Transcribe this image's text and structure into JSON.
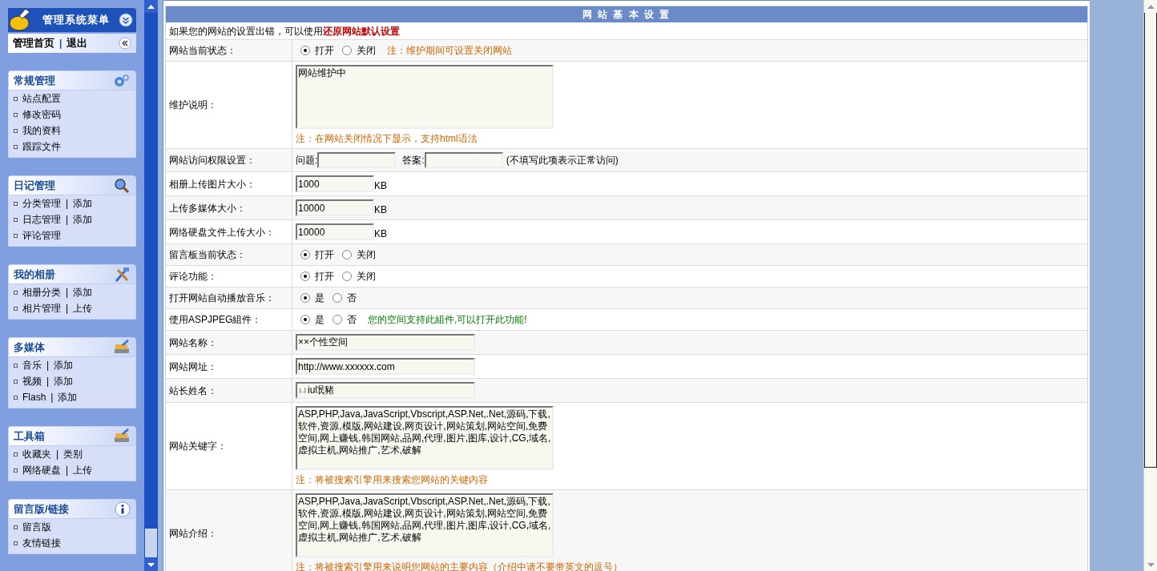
{
  "sidebar": {
    "title": "管理系统菜单",
    "quick_links": {
      "home": "管理首页",
      "separator": "|",
      "logout": "退出"
    },
    "panels": [
      {
        "title": "常规管理",
        "items": [
          {
            "label": "站点配置"
          },
          {
            "label": "修改密码"
          },
          {
            "label": "我的资料"
          },
          {
            "label": "跟踪文件"
          }
        ]
      },
      {
        "title": "日记管理",
        "items": [
          {
            "label": "分类管理",
            "separator": "|",
            "extra": "添加"
          },
          {
            "label": "日志管理",
            "separator": "|",
            "extra": "添加"
          },
          {
            "label": "评论管理"
          }
        ]
      },
      {
        "title": "我的相册",
        "items": [
          {
            "label": "相册分类",
            "separator": "|",
            "extra": "添加"
          },
          {
            "label": "相片管理",
            "separator": "|",
            "extra": "上传"
          }
        ]
      },
      {
        "title": "多媒体",
        "items": [
          {
            "label": "音乐",
            "separator": "|",
            "extra": "添加"
          },
          {
            "label": "视频",
            "separator": "|",
            "extra": "添加"
          },
          {
            "label": "Flash",
            "separator": "|",
            "extra": "添加"
          }
        ]
      },
      {
        "title": "工具箱",
        "items": [
          {
            "label": "收藏夹",
            "separator": "|",
            "extra": "类别"
          },
          {
            "label": "网络硬盘",
            "separator": "|",
            "extra": "上传"
          }
        ]
      },
      {
        "title": "留言版/链接",
        "items": [
          {
            "label": "留言版"
          },
          {
            "label": "友情链接"
          }
        ]
      }
    ]
  },
  "settings": {
    "title": "网 站 基 本 设 置",
    "notice": "如果您的网站的设置出错，可以使用**还原网站默认设置**",
    "rows": [
      {
        "kind": "radio",
        "label": "网站当前状态：",
        "options": [
          {
            "label": "打开",
            "selected": true
          },
          {
            "label": "关闭",
            "selected": false
          }
        ],
        "note": "注：维护期间可设置关闭网站"
      },
      {
        "kind": "textarea",
        "label": "维护说明：",
        "value": "网站维护中",
        "note": "注：在网站关闭情况下显示，支持html语法"
      },
      {
        "kind": "qa",
        "label": "网站访问权限设置：",
        "question_label": "问题:",
        "answer_label": "答案:",
        "hint": "(不填写此项表示正常访问)"
      },
      {
        "kind": "number",
        "label": "相册上传图片大小：",
        "value": "1000",
        "unit": "KB"
      },
      {
        "kind": "number",
        "label": "上传多媒体大小：",
        "value": "10000",
        "unit": "KB"
      },
      {
        "kind": "number",
        "label": "网络硬盘文件上传大小：",
        "value": "10000",
        "unit": "KB"
      },
      {
        "kind": "radio",
        "label": "留言板当前状态：",
        "options": [
          {
            "label": "打开",
            "selected": true
          },
          {
            "label": "关闭",
            "selected": false
          }
        ]
      },
      {
        "kind": "radio",
        "label": "评论功能：",
        "options": [
          {
            "label": "打开",
            "selected": true
          },
          {
            "label": "关闭",
            "selected": false
          }
        ]
      },
      {
        "kind": "radio",
        "label": "打开网站自动播放音乐：",
        "options": [
          {
            "label": "是",
            "selected": true
          },
          {
            "label": "否",
            "selected": false
          }
        ]
      },
      {
        "kind": "radio",
        "label": "使用ASPJPEG組件：",
        "options": [
          {
            "label": "是",
            "selected": true
          },
          {
            "label": "否",
            "selected": false
          }
        ],
        "note": "您的空间支持此組件,可以打开此功能!"
      },
      {
        "kind": "text",
        "label": "网站名称：",
        "value": "××个性空间"
      },
      {
        "kind": "text",
        "label": "网站网址：",
        "value": "http://www.xxxxxx.com"
      },
      {
        "kind": "text",
        "label": "站长姓名：",
        "value": "ㄩiu氓豬"
      },
      {
        "kind": "textarea",
        "label": "网站关键字：",
        "value": "ASP,PHP,Java,JavaScript,Vbscript,ASP.Net,.Net,源码,下载,软件,资源,模版,网站建设,网页设计,网站策划,网站空间,免费空间,网上赚钱,韩国网站,品网,代理,图片,图库,设计,CG,域名,虚拟主机,网站推广,艺术,破解",
        "note": "注：将被搜索引擎用来搜索您网站的关键内容"
      },
      {
        "kind": "textarea",
        "label": "网站介绍：",
        "value": "ASP,PHP,Java,JavaScript,Vbscript,ASP.Net,.Net,源码,下载,软件,资源,模版,网站建设,网页设计,网站策划,网站空间,免费空间,网上赚钱,韩国网站,品网,代理,图片,图库,设计,CG,域名,虚拟主机,网站推广,艺术,破解",
        "note": "注：将被搜索引擎用来说明您网站的主要内容（介绍中请不要带英文的逗号）"
      }
    ]
  }
}
